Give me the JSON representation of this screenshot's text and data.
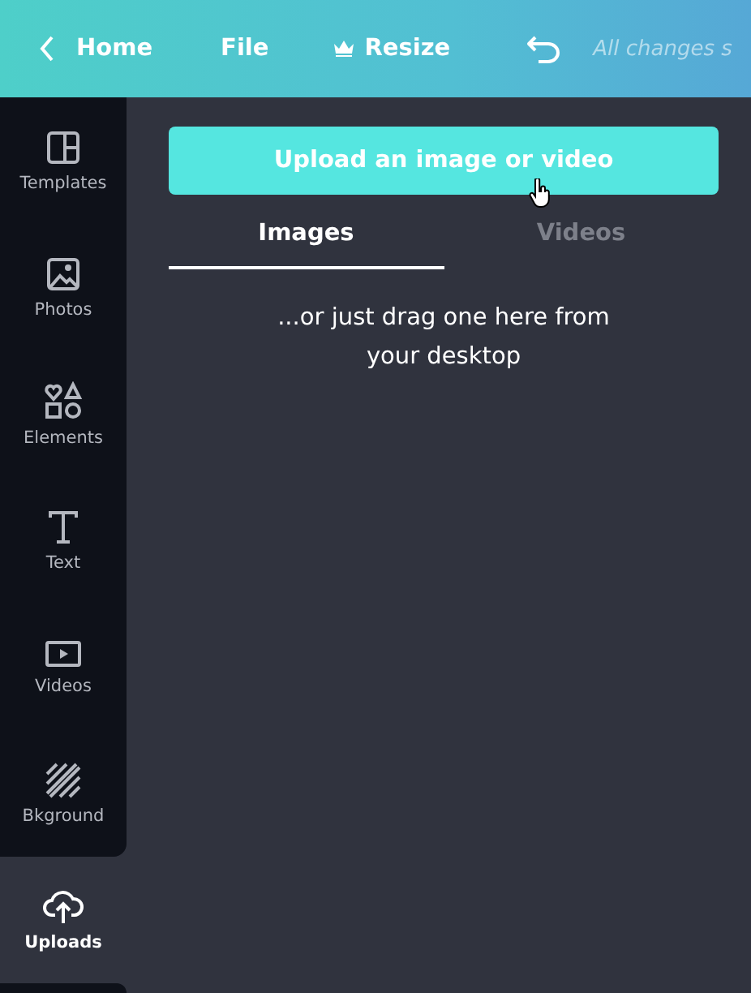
{
  "topbar": {
    "home": "Home",
    "file": "File",
    "resize": "Resize",
    "status": "All changes s"
  },
  "sidebar": {
    "items": [
      {
        "label": "Templates",
        "kind": "templates",
        "selected": false
      },
      {
        "label": "Photos",
        "kind": "photos",
        "selected": false
      },
      {
        "label": "Elements",
        "kind": "elements",
        "selected": false
      },
      {
        "label": "Text",
        "kind": "text",
        "selected": false
      },
      {
        "label": "Videos",
        "kind": "videos",
        "selected": false
      },
      {
        "label": "Bkground",
        "kind": "background",
        "selected": false
      },
      {
        "label": "Uploads",
        "kind": "uploads",
        "selected": true
      }
    ]
  },
  "panel": {
    "upload_button": "Upload an image or video",
    "tabs": [
      {
        "label": "Images",
        "selected": true
      },
      {
        "label": "Videos",
        "selected": false
      }
    ],
    "hint": "...or just drag one here from your desktop"
  }
}
